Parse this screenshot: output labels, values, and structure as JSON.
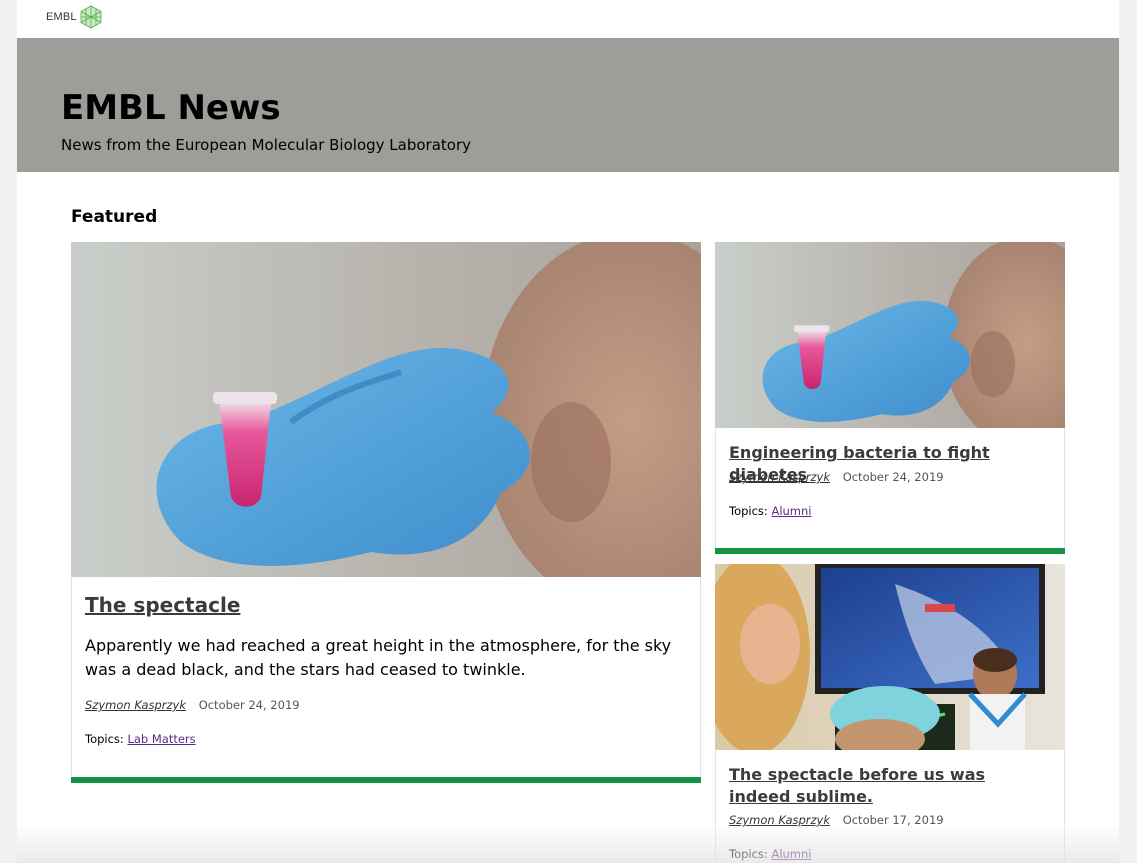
{
  "topbar": {
    "logo_text": "EMBL"
  },
  "masthead": {
    "title": "EMBL News",
    "subtitle": "News from the European Molecular Biology Laboratory"
  },
  "featured": {
    "heading": "Featured",
    "articles": [
      {
        "title": "The spectacle",
        "teaser": "Apparently we had reached a great height in the atmosphere, for the sky was a dead black, and the stars had ceased to twinkle.",
        "author": "Szymon Kasprzyk",
        "date": "October 24, 2019",
        "topics_label": "Topics:",
        "topic": "Lab Matters",
        "image": "scientist-holding-pink-sample-tube"
      },
      {
        "title": "Engineering bacteria to fight diabetes",
        "author": "Szymon Kasprzyk",
        "date": "October 24, 2019",
        "topics_label": "Topics:",
        "topic": "Alumni",
        "image": "scientist-holding-pink-sample-tube"
      },
      {
        "title": "The spectacle before us was indeed sublime.",
        "author": "Szymon Kasprzyk",
        "date": "October 17, 2019",
        "topics_label": "Topics:",
        "topic": "Alumni",
        "image": "children-watching-screen"
      }
    ]
  },
  "colors": {
    "masthead_bg": "#9c9e99",
    "accent_green": "#149345",
    "link_purple": "#5b2a86"
  }
}
